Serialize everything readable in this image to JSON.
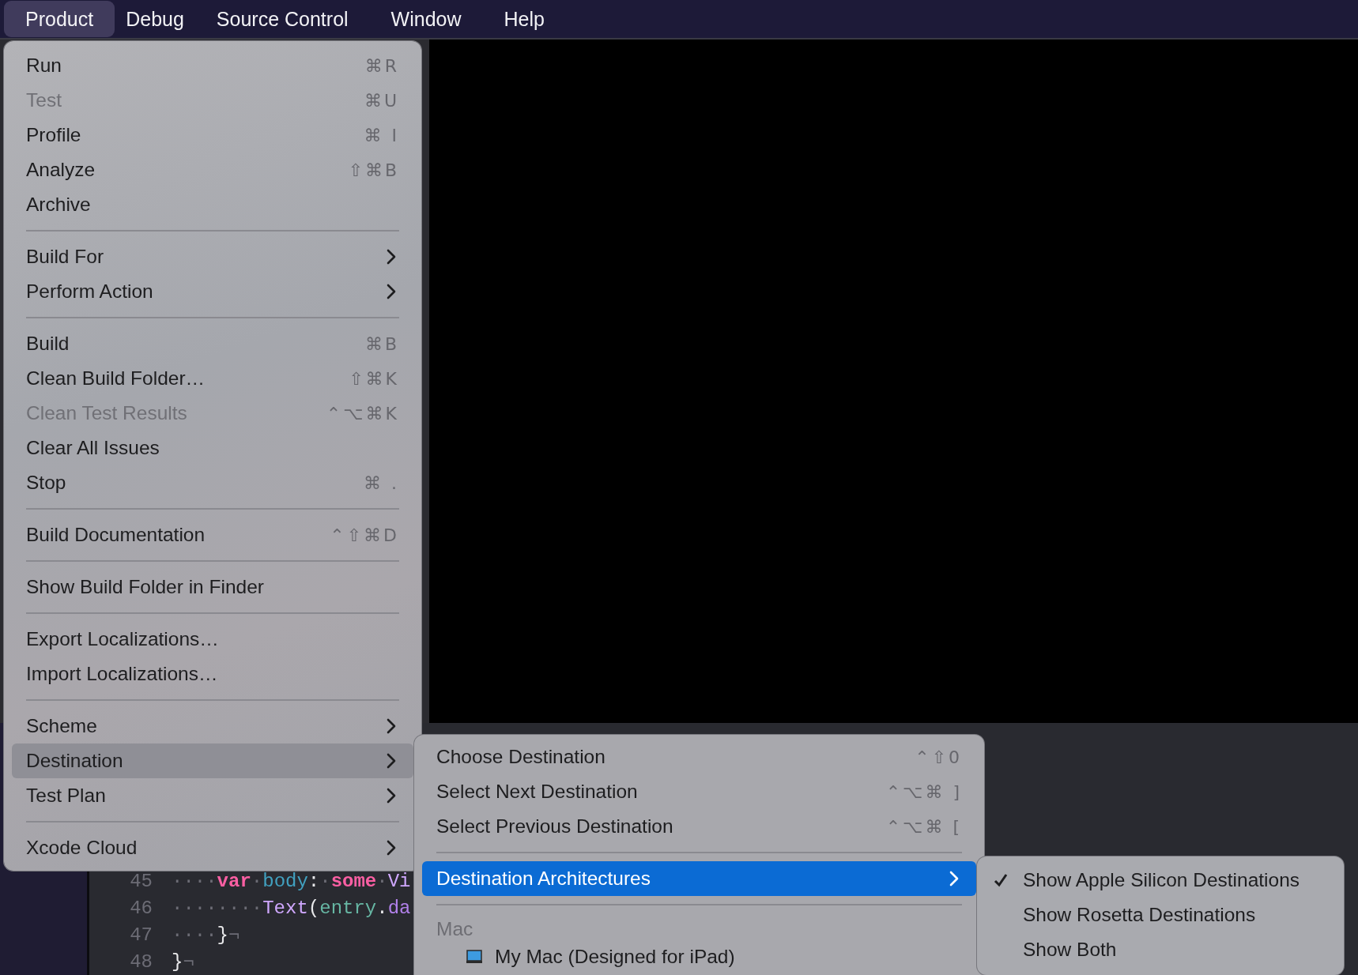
{
  "menu_bar": [
    {
      "label": "Product",
      "selected": true
    },
    {
      "label": "Debug",
      "selected": false
    },
    {
      "label": "Source Control",
      "selected": false
    },
    {
      "label": "Window",
      "selected": false
    },
    {
      "label": "Help",
      "selected": false
    }
  ],
  "product_menu": [
    {
      "kind": "item",
      "label": "Run",
      "shortcut": "⌘R",
      "disabled": false,
      "selected": false,
      "submenu": false
    },
    {
      "kind": "item",
      "label": "Test",
      "shortcut": "⌘U",
      "disabled": true,
      "selected": false,
      "submenu": false
    },
    {
      "kind": "item",
      "label": "Profile",
      "shortcut": "⌘ I",
      "disabled": false,
      "selected": false,
      "submenu": false
    },
    {
      "kind": "item",
      "label": "Analyze",
      "shortcut": "⇧⌘B",
      "disabled": false,
      "selected": false,
      "submenu": false
    },
    {
      "kind": "item",
      "label": "Archive",
      "disabled": false,
      "selected": false,
      "submenu": false
    },
    {
      "kind": "separator"
    },
    {
      "kind": "item",
      "label": "Build For",
      "disabled": false,
      "selected": false,
      "submenu": true
    },
    {
      "kind": "item",
      "label": "Perform Action",
      "disabled": false,
      "selected": false,
      "submenu": true
    },
    {
      "kind": "separator"
    },
    {
      "kind": "item",
      "label": "Build",
      "shortcut": "⌘B",
      "disabled": false,
      "selected": false,
      "submenu": false
    },
    {
      "kind": "item",
      "label": "Clean Build Folder…",
      "shortcut": "⇧⌘K",
      "disabled": false,
      "selected": false,
      "submenu": false
    },
    {
      "kind": "item",
      "label": "Clean Test Results",
      "shortcut": "⌃⌥⌘K",
      "disabled": true,
      "selected": false,
      "submenu": false
    },
    {
      "kind": "item",
      "label": "Clear All Issues",
      "disabled": false,
      "selected": false,
      "submenu": false
    },
    {
      "kind": "item",
      "label": "Stop",
      "shortcut": "⌘ .",
      "disabled": false,
      "selected": false,
      "submenu": false
    },
    {
      "kind": "separator"
    },
    {
      "kind": "item",
      "label": "Build Documentation",
      "shortcut": "⌃⇧⌘D",
      "disabled": false,
      "selected": false,
      "submenu": false
    },
    {
      "kind": "separator"
    },
    {
      "kind": "item",
      "label": "Show Build Folder in Finder",
      "disabled": false,
      "selected": false,
      "submenu": false
    },
    {
      "kind": "separator"
    },
    {
      "kind": "item",
      "label": "Export Localizations…",
      "disabled": false,
      "selected": false,
      "submenu": false
    },
    {
      "kind": "item",
      "label": "Import Localizations…",
      "disabled": false,
      "selected": false,
      "submenu": false
    },
    {
      "kind": "separator"
    },
    {
      "kind": "item",
      "label": "Scheme",
      "disabled": false,
      "selected": false,
      "submenu": true
    },
    {
      "kind": "item",
      "label": "Destination",
      "disabled": false,
      "selected": true,
      "submenu": true
    },
    {
      "kind": "item",
      "label": "Test Plan",
      "disabled": false,
      "selected": false,
      "submenu": true
    },
    {
      "kind": "separator"
    },
    {
      "kind": "item",
      "label": "Xcode Cloud",
      "disabled": false,
      "selected": false,
      "submenu": true
    }
  ],
  "destination_menu": [
    {
      "kind": "item",
      "label": "Choose Destination",
      "shortcut": "⌃⇧0",
      "disabled": false,
      "selected": false,
      "submenu": false
    },
    {
      "kind": "item",
      "label": "Select Next Destination",
      "shortcut": "⌃⌥⌘ ]",
      "disabled": false,
      "selected": false,
      "submenu": false
    },
    {
      "kind": "item",
      "label": "Select Previous Destination",
      "shortcut": "⌃⌥⌘ [",
      "disabled": false,
      "selected": false,
      "submenu": false
    },
    {
      "kind": "separator"
    },
    {
      "kind": "item",
      "label": "Destination Architectures",
      "disabled": false,
      "selected": true,
      "submenu": true
    },
    {
      "kind": "separator"
    },
    {
      "kind": "header",
      "label": "Mac"
    },
    {
      "kind": "device",
      "label": "My Mac (Designed for iPad)"
    }
  ],
  "architectures_menu": [
    {
      "label": "Show Apple Silicon Destinations",
      "checked": true
    },
    {
      "label": "Show Rosetta Destinations",
      "checked": false
    },
    {
      "label": "Show Both",
      "checked": false
    }
  ],
  "editor": {
    "lines": [
      {
        "number": "45",
        "tokens": [
          {
            "text": "····",
            "kind": "space"
          },
          {
            "text": "var",
            "kind": "keyword"
          },
          {
            "text": "·",
            "kind": "space"
          },
          {
            "text": "body",
            "kind": "name"
          },
          {
            "text": ":",
            "kind": "plain"
          },
          {
            "text": "·",
            "kind": "space"
          },
          {
            "text": "some",
            "kind": "keyword"
          },
          {
            "text": "·",
            "kind": "space"
          },
          {
            "text": "Vi",
            "kind": "type"
          }
        ]
      },
      {
        "number": "46",
        "tokens": [
          {
            "text": "········",
            "kind": "space"
          },
          {
            "text": "Text",
            "kind": "type"
          },
          {
            "text": "(",
            "kind": "plain"
          },
          {
            "text": "entry",
            "kind": "variable"
          },
          {
            "text": ".",
            "kind": "plain"
          },
          {
            "text": "da",
            "kind": "member"
          }
        ]
      },
      {
        "number": "47",
        "tokens": [
          {
            "text": "····",
            "kind": "space"
          },
          {
            "text": "}",
            "kind": "plain"
          },
          {
            "text": "¬",
            "kind": "space"
          }
        ]
      },
      {
        "number": "48",
        "tokens": [
          {
            "text": "}",
            "kind": "plain"
          },
          {
            "text": "¬",
            "kind": "space"
          }
        ]
      }
    ]
  }
}
